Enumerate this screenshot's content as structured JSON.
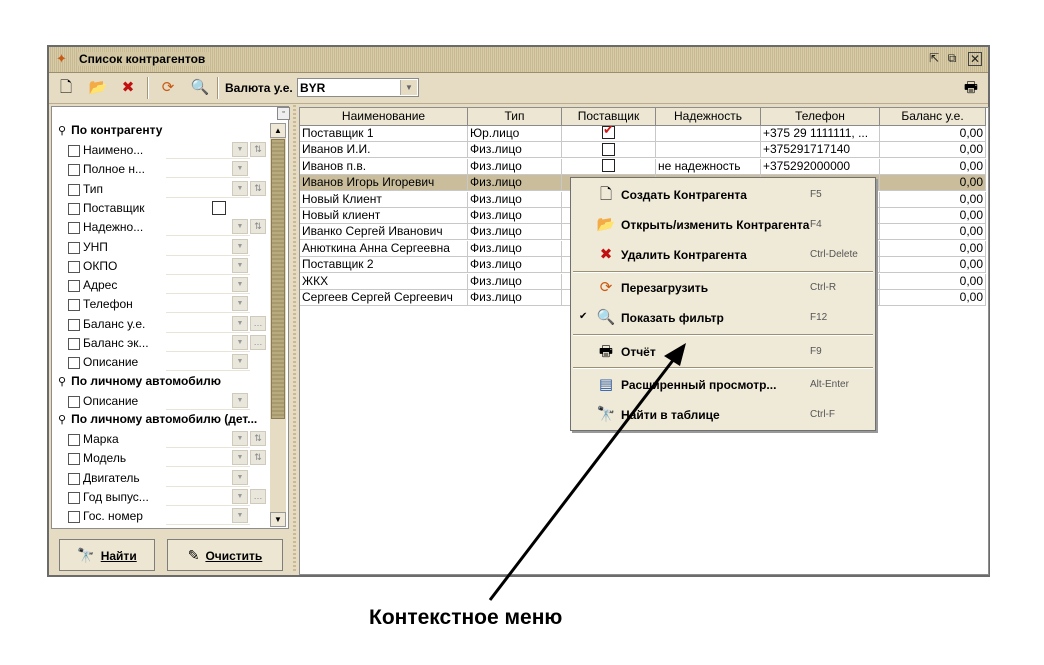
{
  "window": {
    "title": "Список контрагентов"
  },
  "toolbar": {
    "currency_label": "Валюта у.е.",
    "currency_value": "BYR"
  },
  "filter": {
    "groups": [
      {
        "label": "По контрагенту",
        "fields": [
          "Наимено...",
          "Полное н...",
          "Тип",
          "Поставщик",
          "Надежно...",
          "УНП",
          "ОКПО",
          "Адрес",
          "Телефон",
          "Баланс у.е.",
          "Баланс эк...",
          "Описание"
        ]
      },
      {
        "label": "По личному автомобилю",
        "fields": [
          "Описание"
        ]
      },
      {
        "label": "По личному автомобилю (дет...",
        "fields": [
          "Марка",
          "Модель",
          "Двигатель",
          "Год выпус...",
          "Гос. номер"
        ]
      }
    ],
    "find_button": "Найти",
    "clear_button": "Очистить"
  },
  "grid": {
    "columns": [
      "Наименование",
      "Тип",
      "Поставщик",
      "Надежность",
      "Телефон",
      "Баланс у.е."
    ],
    "rows": [
      {
        "name": "Поставщик 1",
        "type": "Юр.лицо",
        "supplier": true,
        "reliability": "",
        "phone": "+375 29 1111111, ...",
        "balance": "0,00"
      },
      {
        "name": "Иванов И.И.",
        "type": "Физ.лицо",
        "supplier": false,
        "reliability": "",
        "phone": "+375291717140",
        "balance": "0,00"
      },
      {
        "name": "Иванов п.в.",
        "type": "Физ.лицо",
        "supplier": false,
        "reliability": "не надежность",
        "phone": "+375292000000",
        "balance": "0,00"
      },
      {
        "name": "Иванов Игорь Игоревич",
        "type": "Физ.лицо",
        "supplier": null,
        "reliability": "",
        "phone": "",
        "balance": "0,00",
        "selected": true
      },
      {
        "name": "Новый Клиент",
        "type": "Физ.лицо",
        "supplier": null,
        "reliability": "",
        "phone": "",
        "balance": "0,00"
      },
      {
        "name": "Новый клиент",
        "type": "Физ.лицо",
        "supplier": null,
        "reliability": "",
        "phone": "",
        "balance": "0,00"
      },
      {
        "name": "Иванко Сергей Иванович",
        "type": "Физ.лицо",
        "supplier": null,
        "reliability": "",
        "phone": "",
        "balance": "0,00"
      },
      {
        "name": "Анюткина Анна Сергеевна",
        "type": "Физ.лицо",
        "supplier": null,
        "reliability": "",
        "phone": "",
        "balance": "0,00"
      },
      {
        "name": "Поставщик 2",
        "type": "Физ.лицо",
        "supplier": null,
        "reliability": "",
        "phone": "",
        "balance": "0,00"
      },
      {
        "name": "ЖКХ",
        "type": "Физ.лицо",
        "supplier": null,
        "reliability": "",
        "phone": "",
        "balance": "0,00"
      },
      {
        "name": "Сергеев Сергей Сергеевич",
        "type": "Физ.лицо",
        "supplier": null,
        "reliability": "",
        "phone": "",
        "balance": "0,00"
      }
    ]
  },
  "context_menu": {
    "items": [
      {
        "label": "Создать Контрагента",
        "shortcut": "F5",
        "icon": "new-document-icon"
      },
      {
        "label": "Открыть/изменить Контрагента",
        "shortcut": "F4",
        "icon": "open-folder-icon"
      },
      {
        "label": "Удалить Контрагента",
        "shortcut": "Ctrl-Delete",
        "icon": "delete-icon"
      },
      {
        "label": "Перезагрузить",
        "shortcut": "Ctrl-R",
        "icon": "reload-icon"
      },
      {
        "label": "Показать фильтр",
        "shortcut": "F12",
        "icon": "filter-icon",
        "checked": true
      },
      {
        "label": "Отчёт",
        "shortcut": "F9",
        "icon": "printer-icon"
      },
      {
        "label": "Расширенный просмотр...",
        "shortcut": "Alt-Enter",
        "icon": "extended-view-icon"
      },
      {
        "label": "Найти в таблице",
        "shortcut": "Ctrl-F",
        "icon": "binoculars-icon"
      }
    ]
  },
  "annotation": "Контекстное меню",
  "colors": {
    "window_bg": "#e6dcc4",
    "selection": "#c9bd9b",
    "check_red": "#d01818"
  }
}
